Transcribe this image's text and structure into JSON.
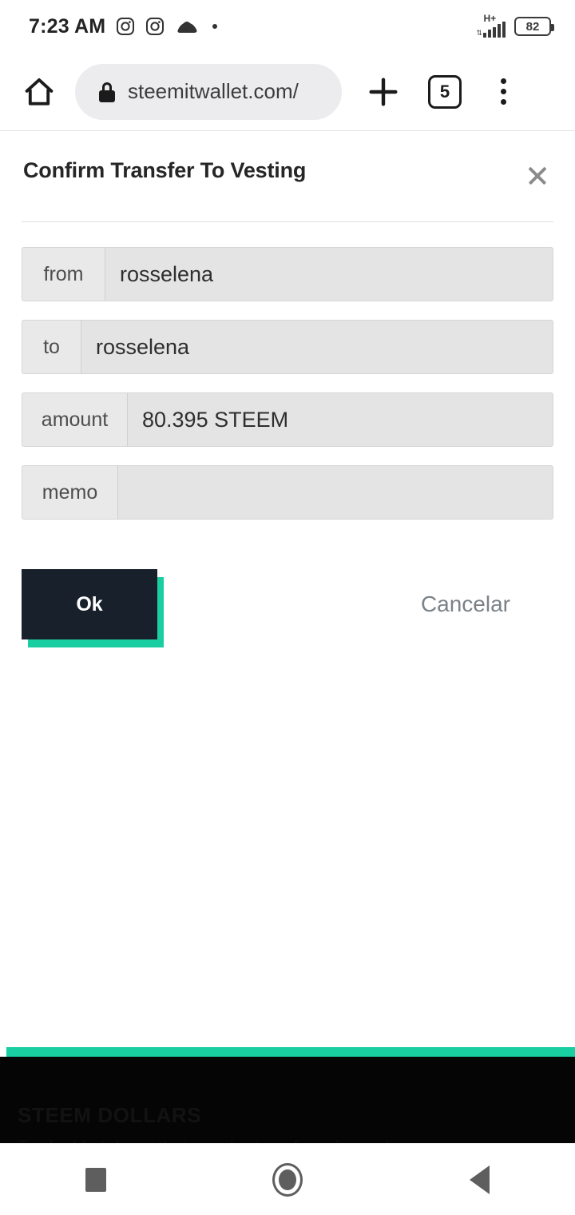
{
  "status_bar": {
    "time": "7:23 AM",
    "icons": [
      "instagram-icon",
      "instagram-icon",
      "cloud-icon",
      "dot-icon"
    ],
    "network_type": "H+",
    "signal_bars": 5,
    "battery_percent": "82"
  },
  "browser": {
    "home_icon": "home-icon",
    "lock_icon": "lock-icon",
    "url": "steemitwallet.com/",
    "new_tab_icon": "plus-icon",
    "tab_count": "5",
    "menu_icon": "overflow-menu-icon"
  },
  "dialog": {
    "title": "Confirm Transfer To Vesting",
    "close_icon": "close-icon",
    "fields": [
      {
        "label": "from",
        "value": "rosselena"
      },
      {
        "label": "to",
        "value": "rosselena"
      },
      {
        "label": "amount",
        "value": "80.395 STEEM"
      },
      {
        "label": "memo",
        "value": ""
      }
    ],
    "ok_label": "Ok",
    "cancel_label": "Cancelar"
  },
  "background_page": {
    "section_title": "STEEM DOLLARS",
    "section_text": "Tradeable tokens that may be transferred anywhere at",
    "accent_color": "#19cfa2",
    "panel_color": "#050505"
  },
  "nav_bar": {
    "recents_icon": "square-recents-icon",
    "home_icon": "circle-home-icon",
    "back_icon": "triangle-back-icon"
  }
}
